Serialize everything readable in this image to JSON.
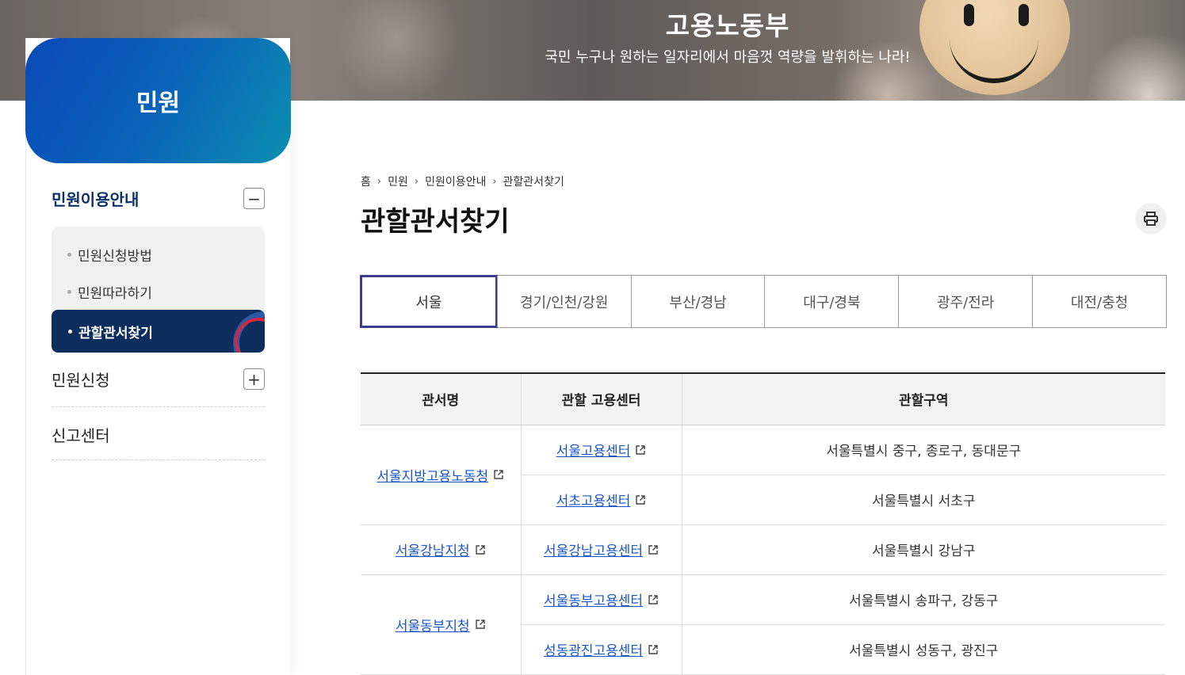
{
  "banner": {
    "title": "고용노동부",
    "subtitle": "국민 누구나 원하는 일자리에서 마음껏 역량을 발휘하는 나라!"
  },
  "sidebar": {
    "heading": "민원",
    "menu": [
      {
        "label": "민원이용안내",
        "toggle": "−",
        "expanded": true,
        "submenu": [
          {
            "label": "민원신청방법"
          },
          {
            "label": "민원따라하기"
          },
          {
            "label": "관할관서찾기",
            "active": true
          }
        ]
      },
      {
        "label": "민원신청",
        "toggle": "+"
      },
      {
        "label": "신고센터"
      }
    ]
  },
  "breadcrumb": [
    "홈",
    "민원",
    "민원이용안내",
    "관할관서찾기"
  ],
  "page_title": "관할관서찾기",
  "tabs": [
    {
      "label": "서울",
      "active": true
    },
    {
      "label": "경기/인천/강원"
    },
    {
      "label": "부산/경남"
    },
    {
      "label": "대구/경북"
    },
    {
      "label": "광주/전라"
    },
    {
      "label": "대전/충청"
    }
  ],
  "table": {
    "headers": [
      "관서명",
      "관할 고용센터",
      "관할구역"
    ],
    "groups": [
      {
        "office": "서울지방고용노동청",
        "centers": [
          {
            "center": "서울고용센터",
            "area": "서울특별시 중구, 종로구, 동대문구"
          },
          {
            "center": "서초고용센터",
            "area": "서울특별시 서초구"
          }
        ]
      },
      {
        "office": "서울강남지청",
        "centers": [
          {
            "center": "서울강남고용센터",
            "area": "서울특별시 강남구"
          }
        ]
      },
      {
        "office": "서울동부지청",
        "centers": [
          {
            "center": "서울동부고용센터",
            "area": "서울특별시 송파구, 강동구"
          },
          {
            "center": "성동광진고용센터",
            "area": "서울특별시 성동구, 광진구"
          }
        ]
      }
    ]
  },
  "colors": {
    "brand_blue": "#0a4ab8",
    "nav_active": "#0d2d5c",
    "tab_active_border": "#3b3d8f",
    "link": "#1a56c9"
  },
  "icons": {
    "print": "printer-icon",
    "external": "external-link-icon"
  }
}
